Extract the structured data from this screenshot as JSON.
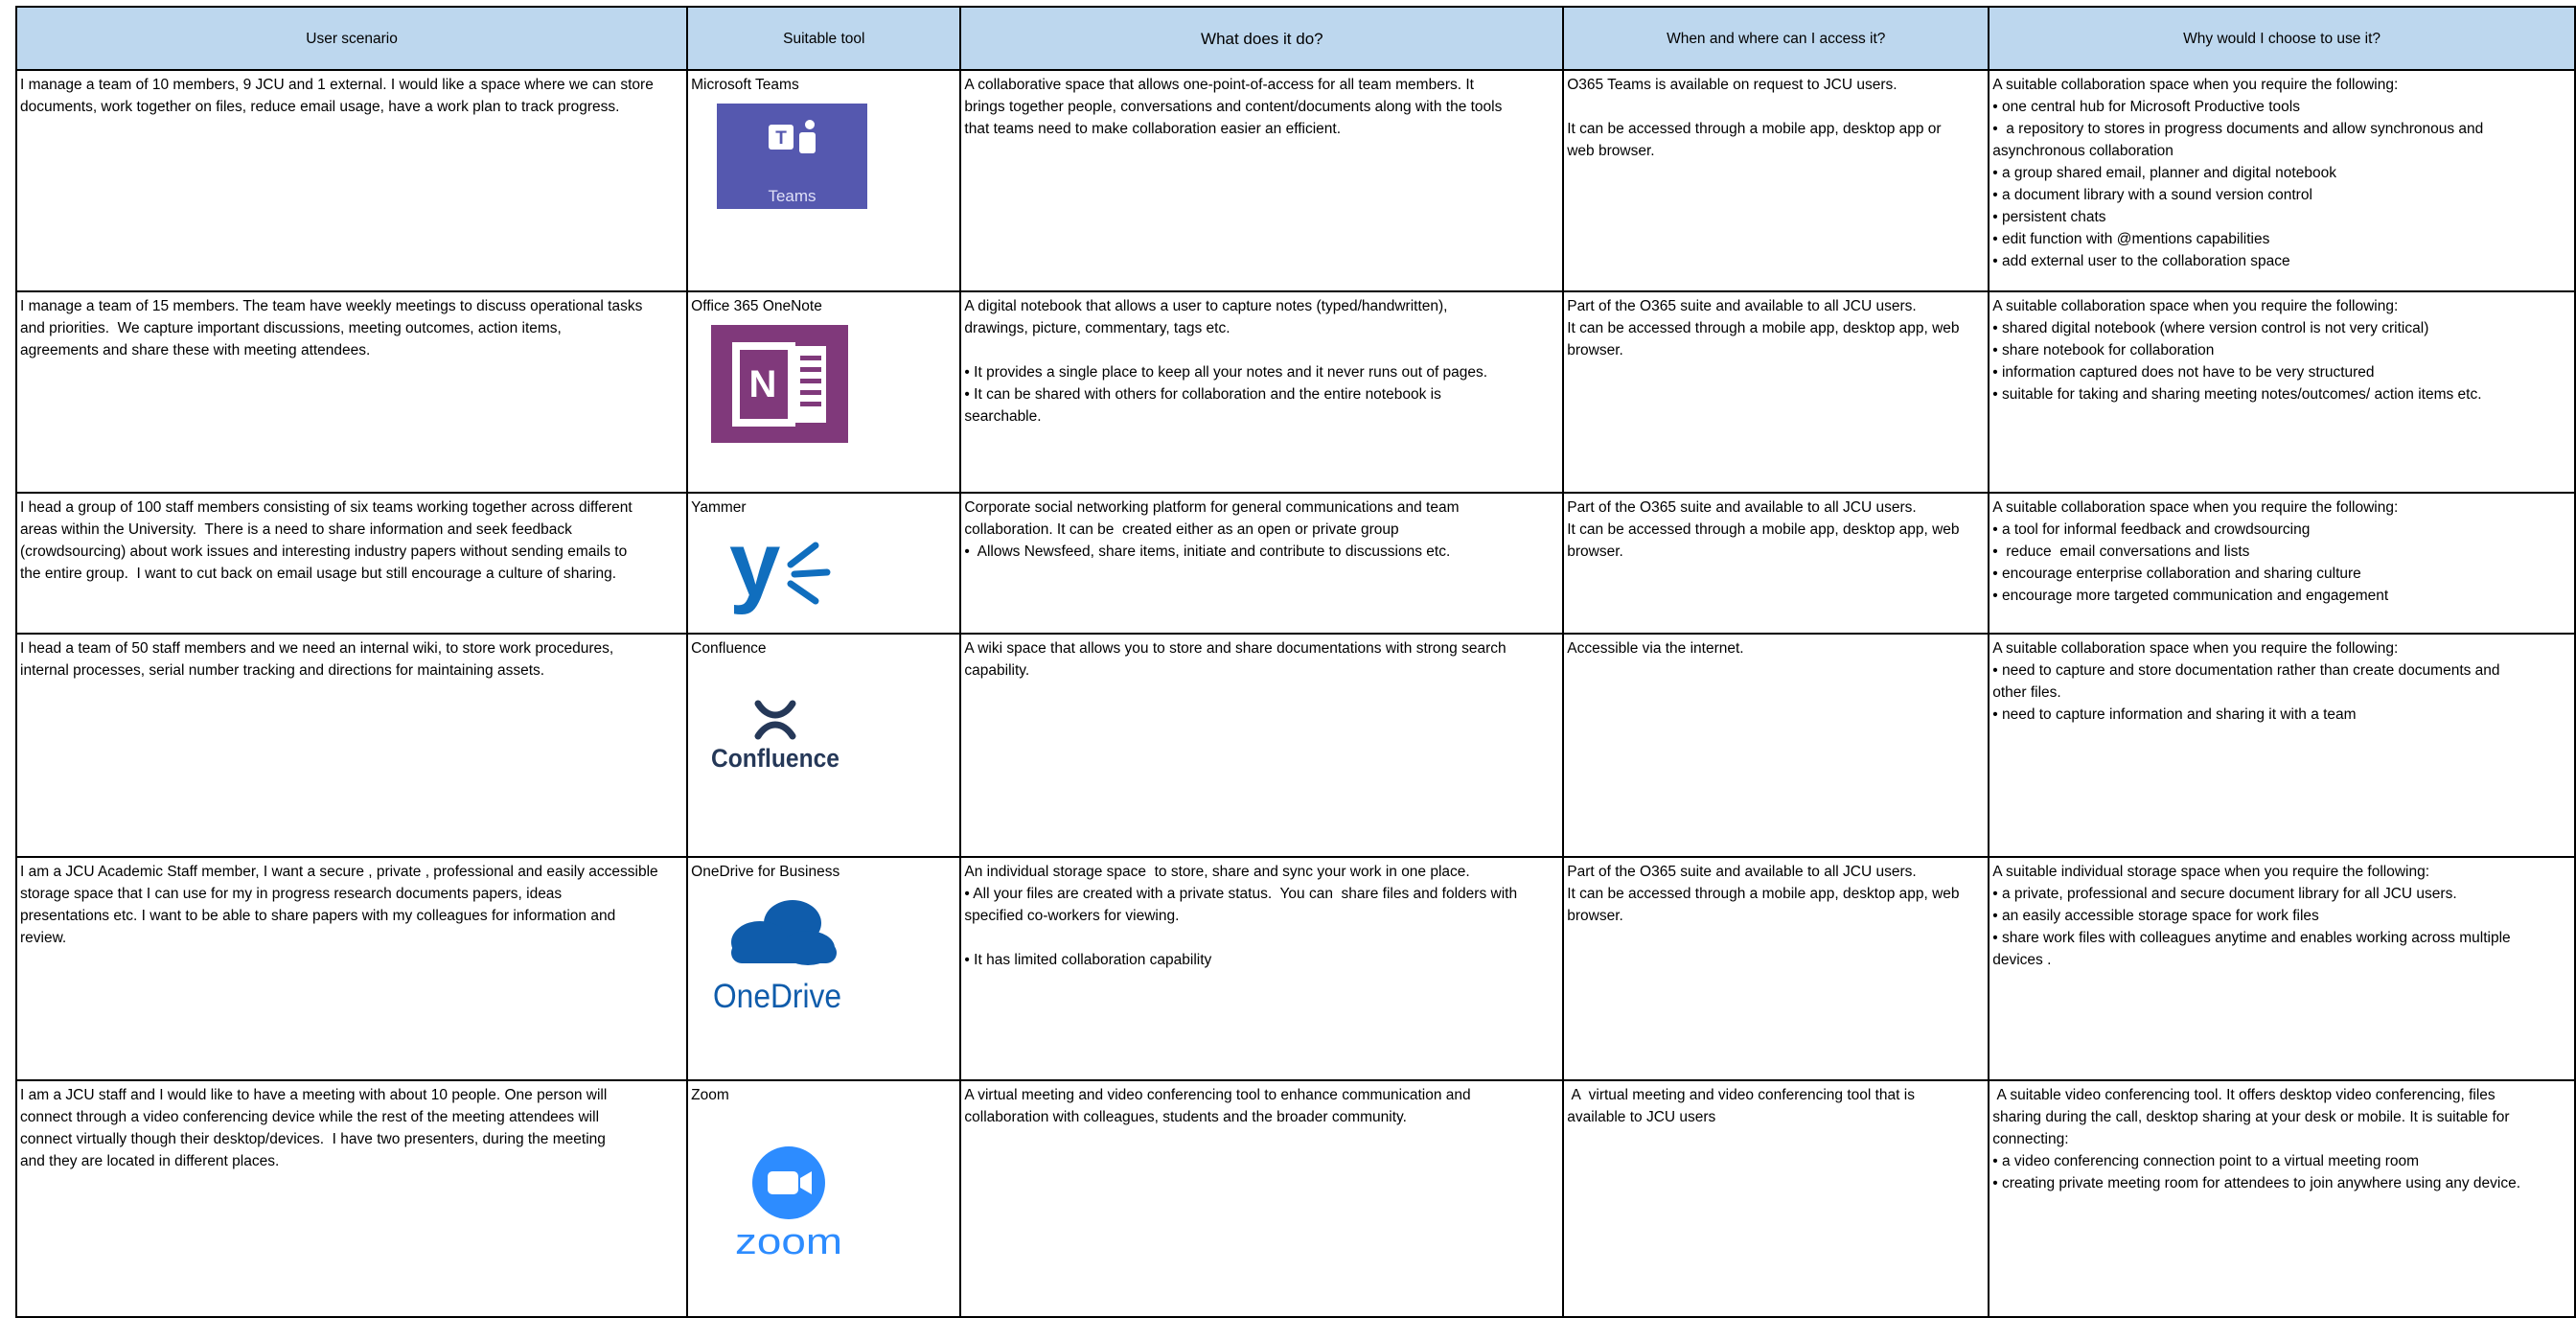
{
  "headers": {
    "scenario": "User scenario",
    "tool": "Suitable tool",
    "what": "What does it do?",
    "when": "When and where can I access it?",
    "why": "Why would I choose to use it?"
  },
  "rows": [
    {
      "scenario": [
        "I manage a team of 10 members, 9 JCU and 1 external. I would like a space where we can store",
        "documents, work together on files, reduce email usage, have a work plan to track progress."
      ],
      "tool": "Microsoft Teams",
      "logo_text": "Teams",
      "what": [
        "A collaborative space that allows one-point-of-access for all team members. It",
        "brings together people, conversations and content/documents along with the tools",
        "that teams need to make collaboration easier an efficient."
      ],
      "when": [
        "O365 Teams is available on request to JCU users.",
        "",
        "It can be accessed through a mobile app, desktop app or",
        "web browser."
      ],
      "why": [
        "A suitable collaboration space when you require the following:",
        "• one central hub for Microsoft Productive tools",
        "•  a repository to stores in progress documents and allow synchronous and",
        "asynchronous collaboration",
        "• a group shared email, planner and digital notebook",
        "• a document library with a sound version control",
        "• persistent chats",
        "• edit function with @mentions capabilities",
        "• add external user to the collaboration space"
      ]
    },
    {
      "scenario": [
        "I manage a team of 15 members. The team have weekly meetings to discuss operational tasks",
        "and priorities.  We capture important discussions, meeting outcomes, action items,",
        "agreements and share these with meeting attendees."
      ],
      "tool": "Office 365 OneNote",
      "logo_text": "N",
      "what": [
        "A digital notebook that allows a user to capture notes (typed/handwritten),",
        "drawings, picture, commentary, tags etc.",
        "",
        "• It provides a single place to keep all your notes and it never runs out of pages.",
        "• It can be shared with others for collaboration and the entire notebook is",
        "searchable."
      ],
      "when": [
        "Part of the O365 suite and available to all JCU users.",
        "It can be accessed through a mobile app, desktop app, web",
        "browser."
      ],
      "why": [
        "A suitable collaboration space when you require the following:",
        "• shared digital notebook (where version control is not very critical)",
        "• share notebook for collaboration",
        "• information captured does not have to be very structured",
        "• suitable for taking and sharing meeting notes/outcomes/ action items etc."
      ]
    },
    {
      "scenario": [
        "I head a group of 100 staff members consisting of six teams working together across different",
        "areas within the University.  There is a need to share information and seek feedback",
        "(crowdsourcing) about work issues and interesting industry papers without sending emails to",
        "the entire group.  I want to cut back on email usage but still encourage a culture of sharing."
      ],
      "tool": "Yammer",
      "logo_text": "y",
      "what": [
        "Corporate social networking platform for general communications and team",
        "collaboration. It can be  created either as an open or private group",
        "•  Allows Newsfeed, share items, initiate and contribute to discussions etc."
      ],
      "when": [
        "Part of the O365 suite and available to all JCU users.",
        "It can be accessed through a mobile app, desktop app, web",
        "browser."
      ],
      "why": [
        "A suitable collaboration space when you require the following:",
        "• a tool for informal feedback and crowdsourcing",
        "•  reduce  email conversations and lists",
        "• encourage enterprise collaboration and sharing culture",
        "• encourage more targeted communication and engagement"
      ]
    },
    {
      "scenario": [
        "I head a team of 50 staff members and we need an internal wiki, to store work procedures,",
        "internal processes, serial number tracking and directions for maintaining assets."
      ],
      "tool": "Confluence",
      "logo_text": "Confluence",
      "what": [
        "A wiki space that allows you to store and share documentations with strong search",
        "capability."
      ],
      "when": [
        "Accessible via the internet."
      ],
      "why": [
        "A suitable collaboration space when you require the following:",
        "• need to capture and store documentation rather than create documents and",
        "other files.",
        "• need to capture information and sharing it with a team"
      ]
    },
    {
      "scenario": [
        "I am a JCU Academic Staff member, I want a secure , private , professional and easily accessible",
        "storage space that I can use for my in progress research documents papers, ideas",
        "presentations etc. I want to be able to share papers with my colleagues for information and",
        "review."
      ],
      "tool": "OneDrive for Business",
      "logo_text": "OneDrive",
      "what": [
        "An individual storage space  to store, share and sync your work in one place.",
        "• All your files are created with a private status.  You can  share files and folders with",
        "specified co-workers for viewing.",
        "",
        "• It has limited collaboration capability"
      ],
      "when": [
        "Part of the O365 suite and available to all JCU users.",
        "It can be accessed through a mobile app, desktop app, web",
        "browser."
      ],
      "why": [
        "A suitable individual storage space when you require the following:",
        "• a private, professional and secure document library for all JCU users.",
        "• an easily accessible storage space for work files",
        "• share work files with colleagues anytime and enables working across multiple",
        "devices ."
      ]
    },
    {
      "scenario": [
        "I am a JCU staff and I would like to have a meeting with about 10 people. One person will",
        "connect through a video conferencing device while the rest of the meeting attendees will",
        "connect virtually though their desktop/devices.  I have two presenters, during the meeting",
        "and they are located in different places."
      ],
      "tool": "Zoom",
      "logo_text": "zoom",
      "what": [
        "A virtual meeting and video conferencing tool to enhance communication and",
        "collaboration with colleagues, students and the broader community."
      ],
      "when": [
        " A  virtual meeting and video conferencing tool that is",
        "available to JCU users"
      ],
      "why": [
        " A suitable video conferencing tool. It offers desktop video conferencing, files",
        "sharing during the call, desktop sharing at your desk or mobile. It is suitable for",
        "connecting:",
        "• a video conferencing connection point to a virtual meeting room",
        "• creating private meeting room for attendees to join anywhere using any device."
      ]
    }
  ],
  "colors": {
    "header_bg": "#bdd7ee",
    "teams": "#5558af",
    "onenote": "#80397b",
    "yammer": "#106ebe",
    "confluence": "#253858",
    "onedrive": "#0f5cab",
    "zoom": "#2d8cff"
  }
}
